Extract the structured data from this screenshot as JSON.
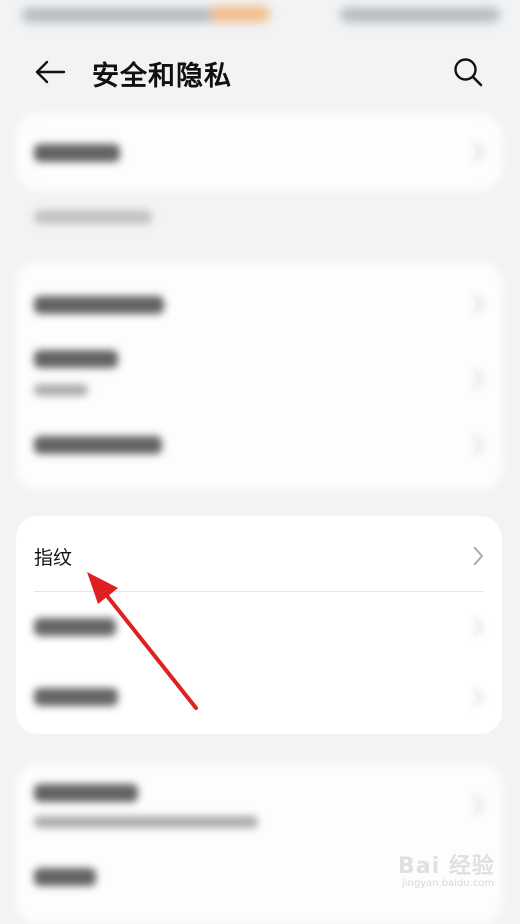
{
  "header": {
    "title": "安全和隐私",
    "back_icon": "arrow-left-icon",
    "search_icon": "search-icon"
  },
  "cards": {
    "fingerprint": {
      "label": "指纹"
    }
  },
  "watermark": {
    "brand": "Bai 经验",
    "url": "jingyan.baidu.com"
  },
  "colors": {
    "background": "#f1f3f5",
    "card": "#ffffff",
    "annotation_arrow": "#e02020"
  }
}
